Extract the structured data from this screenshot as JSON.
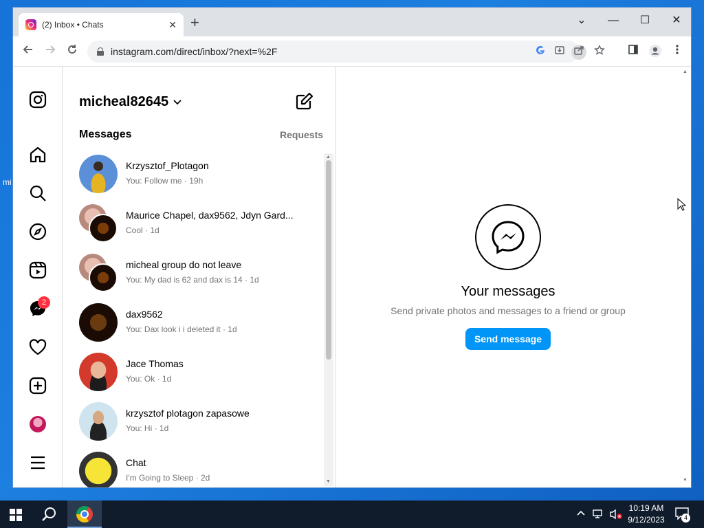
{
  "desktop": {
    "edge_label": "mi"
  },
  "browser": {
    "tab_title": "(2) Inbox • Chats",
    "tab_close": "✕",
    "new_tab": "+",
    "url": "instagram.com/direct/inbox/?next=%2F",
    "controls": {
      "dropdown": "⌄",
      "minimize": "—",
      "maximize": "☐",
      "close": "✕"
    }
  },
  "inbox": {
    "username": "micheal82645",
    "messages_heading": "Messages",
    "requests_label": "Requests",
    "chats": [
      {
        "name": "Krzysztof_Plotagon",
        "preview": "You: Follow me · 19h"
      },
      {
        "name": "Maurice Chapel, dax9562, Jdyn Gard...",
        "preview": "Cool · 1d"
      },
      {
        "name": "micheal group do not leave",
        "preview": "You: My dad is 62 and dax is 14 · 1d"
      },
      {
        "name": "dax9562",
        "preview": "You: Dax look i i deleted it · 1d"
      },
      {
        "name": "Jace Thomas",
        "preview": "You: Ok · 1d"
      },
      {
        "name": "krzysztof plotagon zapasowe",
        "preview": "You: Hi · 1d"
      },
      {
        "name": "Chat",
        "preview": "I'm Going to Sleep · 2d"
      }
    ]
  },
  "nav": {
    "messenger_badge": "2"
  },
  "main": {
    "title": "Your messages",
    "subtitle": "Send private photos and messages to a friend or group",
    "send_button": "Send message"
  },
  "taskbar": {
    "time": "10:19 AM",
    "date": "9/12/2023",
    "notification_count": "4"
  },
  "colors": {
    "instagram_blue": "#0095f6",
    "badge_red": "#ff3040",
    "desktop_blue": "#1673d8"
  }
}
